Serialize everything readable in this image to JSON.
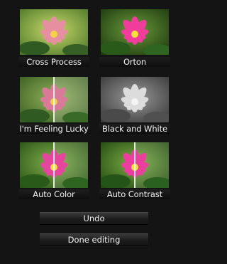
{
  "effects": [
    {
      "label": "Cross Process"
    },
    {
      "label": "Orton"
    },
    {
      "label": "I'm Feeling Lucky"
    },
    {
      "label": "Black and White"
    },
    {
      "label": "Auto Color"
    },
    {
      "label": "Auto Contrast"
    }
  ],
  "actions": {
    "undo_label": "Undo",
    "done_label": "Done editing"
  }
}
